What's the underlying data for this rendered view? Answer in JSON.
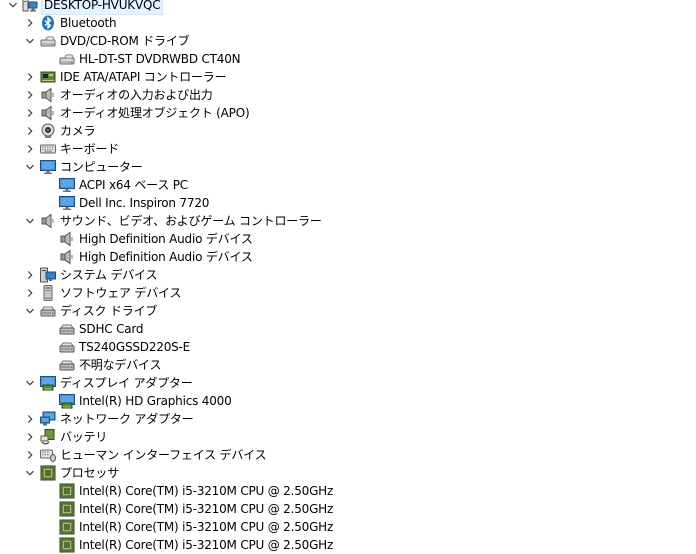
{
  "tree": {
    "root": {
      "label": "DESKTOP-HVUKVQC",
      "icon": "computer-root-icon"
    },
    "categories": [
      {
        "label": "Bluetooth",
        "icon": "bluetooth-icon",
        "expanded": false,
        "children": []
      },
      {
        "label": "DVD/CD-ROM ドライブ",
        "icon": "optical-drive-icon",
        "expanded": true,
        "children": [
          {
            "label": "HL-DT-ST DVDRWBD CT40N",
            "icon": "optical-drive-icon"
          }
        ]
      },
      {
        "label": "IDE ATA/ATAPI コントローラー",
        "icon": "ide-controller-icon",
        "expanded": false,
        "children": []
      },
      {
        "label": "オーディオの入力および出力",
        "icon": "speaker-icon",
        "expanded": false,
        "children": []
      },
      {
        "label": "オーディオ処理オブジェクト (APO)",
        "icon": "speaker-icon",
        "expanded": false,
        "children": []
      },
      {
        "label": "カメラ",
        "icon": "camera-icon",
        "expanded": false,
        "children": []
      },
      {
        "label": "キーボード",
        "icon": "keyboard-icon",
        "expanded": false,
        "children": []
      },
      {
        "label": "コンピューター",
        "icon": "monitor-icon",
        "expanded": true,
        "children": [
          {
            "label": "ACPI x64 ベース PC",
            "icon": "monitor-icon"
          },
          {
            "label": "Dell Inc. Inspiron 7720",
            "icon": "monitor-icon"
          }
        ]
      },
      {
        "label": "サウンド、ビデオ、およびゲーム コントローラー",
        "icon": "speaker-icon",
        "expanded": true,
        "children": [
          {
            "label": "High Definition Audio デバイス",
            "icon": "speaker-icon"
          },
          {
            "label": "High Definition Audio デバイス",
            "icon": "speaker-icon"
          }
        ]
      },
      {
        "label": "システム デバイス",
        "icon": "system-device-icon",
        "expanded": false,
        "children": []
      },
      {
        "label": "ソフトウェア デバイス",
        "icon": "software-device-icon",
        "expanded": false,
        "children": []
      },
      {
        "label": "ディスク ドライブ",
        "icon": "disk-drive-icon",
        "expanded": true,
        "children": [
          {
            "label": "SDHC Card",
            "icon": "disk-drive-icon"
          },
          {
            "label": "TS240GSSD220S-E",
            "icon": "disk-drive-icon"
          },
          {
            "label": "不明なデバイス",
            "icon": "disk-drive-icon"
          }
        ]
      },
      {
        "label": "ディスプレイ アダプター",
        "icon": "display-adapter-icon",
        "expanded": true,
        "children": [
          {
            "label": "Intel(R) HD Graphics 4000",
            "icon": "display-adapter-icon"
          }
        ]
      },
      {
        "label": "ネットワーク アダプター",
        "icon": "network-adapter-icon",
        "expanded": false,
        "children": []
      },
      {
        "label": "バッテリ",
        "icon": "battery-icon",
        "expanded": false,
        "children": []
      },
      {
        "label": "ヒューマン インターフェイス デバイス",
        "icon": "hid-icon",
        "expanded": false,
        "children": []
      },
      {
        "label": "プロセッサ",
        "icon": "processor-icon",
        "expanded": true,
        "children": [
          {
            "label": "Intel(R) Core(TM) i5-3210M CPU @ 2.50GHz",
            "icon": "processor-icon"
          },
          {
            "label": "Intel(R) Core(TM) i5-3210M CPU @ 2.50GHz",
            "icon": "processor-icon"
          },
          {
            "label": "Intel(R) Core(TM) i5-3210M CPU @ 2.50GHz",
            "icon": "processor-icon"
          },
          {
            "label": "Intel(R) Core(TM) i5-3210M CPU @ 2.50GHz",
            "icon": "processor-icon"
          }
        ]
      }
    ]
  }
}
